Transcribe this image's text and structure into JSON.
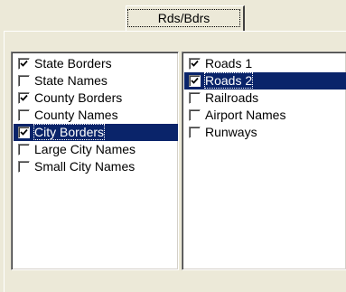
{
  "tab": {
    "label": "Rds/Bdrs"
  },
  "left_list": {
    "items": [
      {
        "label": "State Borders",
        "checked": true,
        "selected": false
      },
      {
        "label": "State Names",
        "checked": false,
        "selected": false
      },
      {
        "label": "County Borders",
        "checked": true,
        "selected": false
      },
      {
        "label": "County Names",
        "checked": false,
        "selected": false
      },
      {
        "label": "City Borders",
        "checked": true,
        "selected": true
      },
      {
        "label": "Large City Names",
        "checked": false,
        "selected": false
      },
      {
        "label": "Small City Names",
        "checked": false,
        "selected": false
      }
    ]
  },
  "right_list": {
    "items": [
      {
        "label": "Roads 1",
        "checked": true,
        "selected": false
      },
      {
        "label": "Roads 2",
        "checked": true,
        "selected": true
      },
      {
        "label": "Railroads",
        "checked": false,
        "selected": false
      },
      {
        "label": "Airport Names",
        "checked": false,
        "selected": false
      },
      {
        "label": "Runways",
        "checked": false,
        "selected": false
      }
    ]
  },
  "colors": {
    "selection": "#0a246a",
    "face": "#ece9d8"
  }
}
